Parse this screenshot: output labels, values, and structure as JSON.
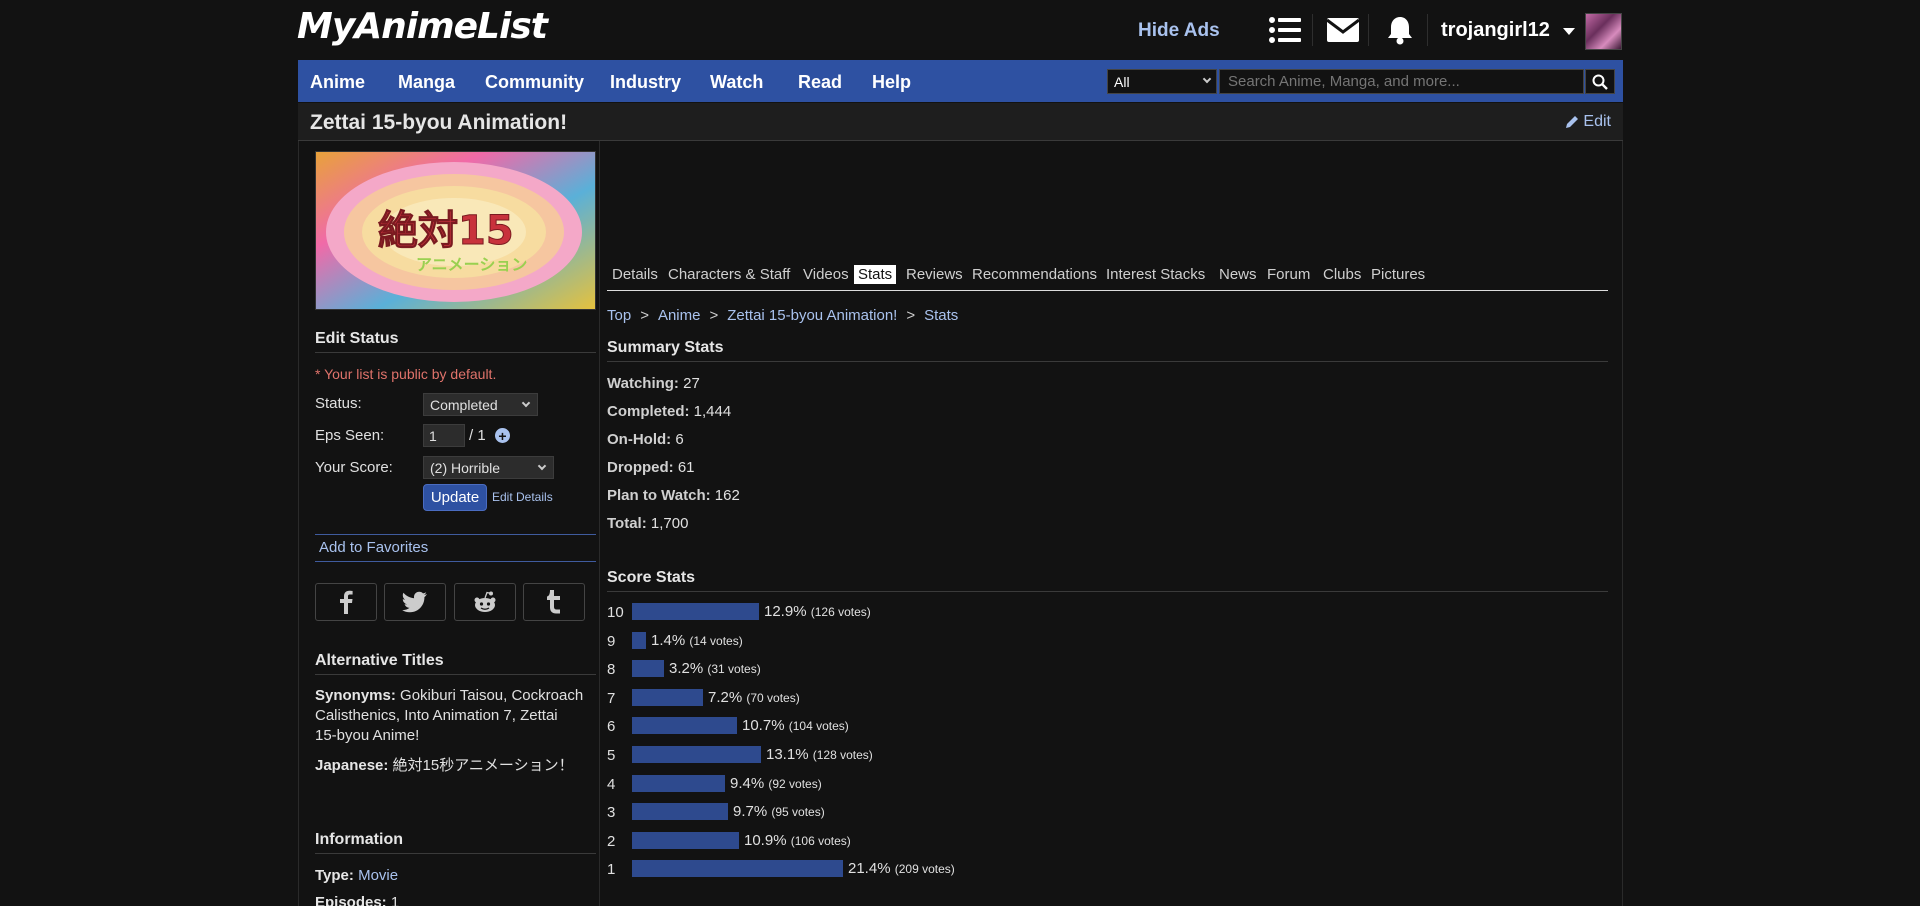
{
  "header": {
    "logo": "MyAnimeList",
    "hide_ads": "Hide Ads",
    "username": "trojangirl12",
    "icons": [
      "list-icon",
      "mail-icon",
      "bell-icon"
    ]
  },
  "nav": {
    "items": [
      "Anime",
      "Manga",
      "Community",
      "Industry",
      "Watch",
      "Read",
      "Help"
    ],
    "search_type": "All",
    "search_placeholder": "Search Anime, Manga, and more..."
  },
  "title_bar": {
    "title": "Zettai 15-byou Animation!",
    "edit": "Edit"
  },
  "edit_status": {
    "heading": "Edit Status",
    "public_note": "* Your list is public by default.",
    "status_label": "Status:",
    "status_value": "Completed",
    "eps_label": "Eps Seen:",
    "eps_value": "1",
    "eps_total": "/ 1",
    "score_label": "Your Score:",
    "score_value": "(2) Horrible",
    "update": "Update",
    "edit_details": "Edit Details"
  },
  "favorites": "Add to Favorites",
  "share_icons": [
    "facebook-icon",
    "twitter-icon",
    "reddit-icon",
    "tumblr-icon"
  ],
  "alt_titles": {
    "heading": "Alternative Titles",
    "synonyms_label": "Synonyms:",
    "synonyms_line1": "Gokiburi Taisou, Cockroach",
    "synonyms_line2": "Calisthenics, Into Animation 7, Zettai",
    "synonyms_line3": "15-byou Anime!",
    "japanese_label": "Japanese:",
    "japanese_value": "絶対15秒アニメーション！"
  },
  "information": {
    "heading": "Information",
    "type_label": "Type:",
    "type_value": "Movie",
    "episodes_label": "Episodes:",
    "episodes_value": "1"
  },
  "tabs": [
    "Details",
    "Characters & Staff",
    "Videos",
    "Stats",
    "Reviews",
    "Recommendations",
    "Interest Stacks",
    "News",
    "Forum",
    "Clubs",
    "Pictures"
  ],
  "active_tab": "Stats",
  "breadcrumb": [
    "Top",
    "Anime",
    "Zettai 15-byou Animation!",
    "Stats"
  ],
  "summary": {
    "heading": "Summary Stats",
    "rows": [
      {
        "label": "Watching:",
        "value": "27"
      },
      {
        "label": "Completed:",
        "value": "1,444"
      },
      {
        "label": "On-Hold:",
        "value": "6"
      },
      {
        "label": "Dropped:",
        "value": "61"
      },
      {
        "label": "Plan to Watch:",
        "value": "162"
      },
      {
        "label": "Total:",
        "value": "1,700"
      }
    ]
  },
  "score_stats": {
    "heading": "Score Stats",
    "rows": [
      {
        "score": "10",
        "percent": 12.9,
        "pct_text": "12.9%",
        "votes": "(126 votes)"
      },
      {
        "score": "9",
        "percent": 1.4,
        "pct_text": "1.4%",
        "votes": "(14 votes)"
      },
      {
        "score": "8",
        "percent": 3.2,
        "pct_text": "3.2%",
        "votes": "(31 votes)"
      },
      {
        "score": "7",
        "percent": 7.2,
        "pct_text": "7.2%",
        "votes": "(70 votes)"
      },
      {
        "score": "6",
        "percent": 10.7,
        "pct_text": "10.7%",
        "votes": "(104 votes)"
      },
      {
        "score": "5",
        "percent": 13.1,
        "pct_text": "13.1%",
        "votes": "(128 votes)"
      },
      {
        "score": "4",
        "percent": 9.4,
        "pct_text": "9.4%",
        "votes": "(92 votes)"
      },
      {
        "score": "3",
        "percent": 9.7,
        "pct_text": "9.7%",
        "votes": "(95 votes)"
      },
      {
        "score": "2",
        "percent": 10.9,
        "pct_text": "10.9%",
        "votes": "(106 votes)"
      },
      {
        "score": "1",
        "percent": 21.4,
        "pct_text": "21.4%",
        "votes": "(209 votes)"
      }
    ]
  },
  "colors": {
    "background": "#121212",
    "nav_blue": "#2e51a2",
    "link_blue": "#a9c2ee",
    "bar_blue": "#2e4a8e",
    "note_red": "#e0736b"
  }
}
